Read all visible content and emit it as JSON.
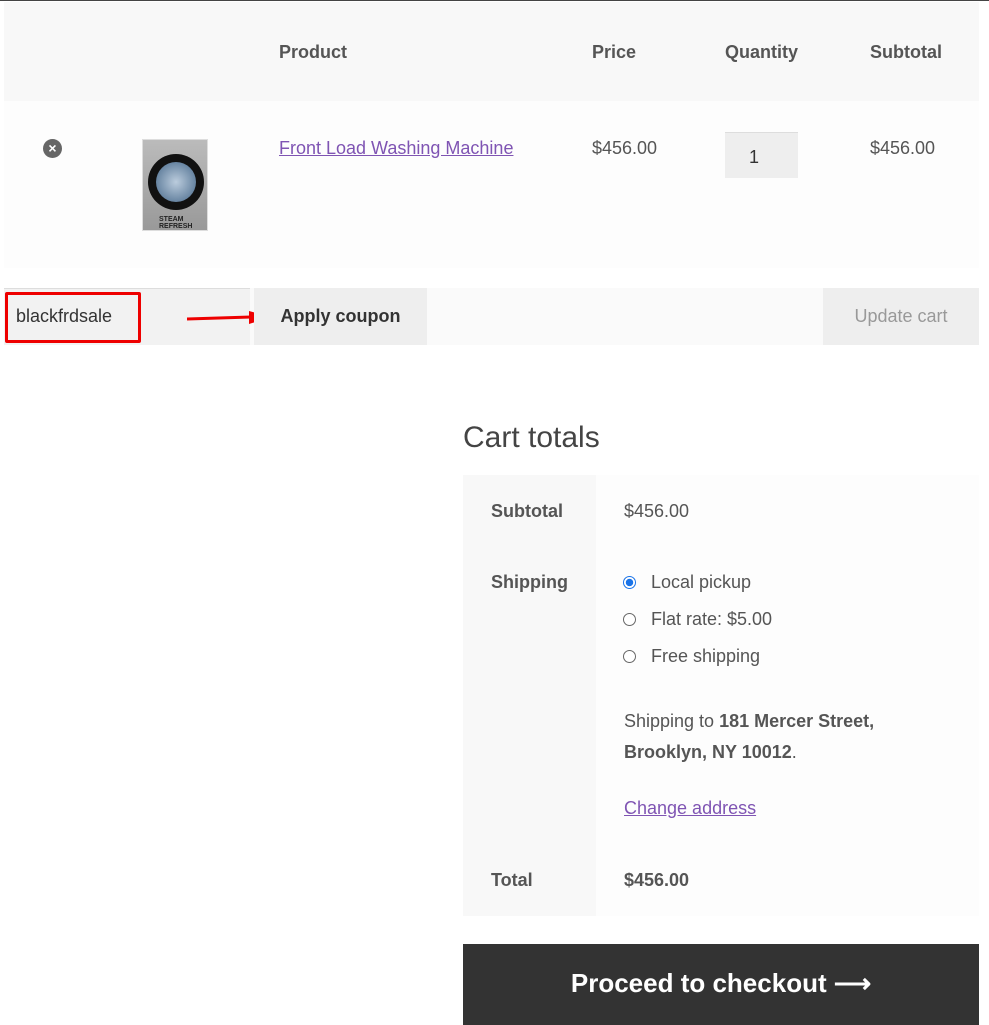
{
  "table": {
    "headers": {
      "product": "Product",
      "price": "Price",
      "quantity": "Quantity",
      "subtotal": "Subtotal"
    },
    "items": [
      {
        "name": "Front Load Washing Machine",
        "image_text": "STEAM REFRESH",
        "price": "$456.00",
        "quantity": "1",
        "subtotal": "$456.00"
      }
    ]
  },
  "coupon": {
    "value": "blackfrdsale",
    "apply_label": "Apply coupon",
    "update_label": "Update cart",
    "highlight_color": "#ee0000"
  },
  "totals": {
    "title": "Cart totals",
    "subtotal_label": "Subtotal",
    "subtotal": "$456.00",
    "shipping_label": "Shipping",
    "options": [
      {
        "label": "Local pickup",
        "selected": true
      },
      {
        "label": "Flat rate: $5.00",
        "selected": false
      },
      {
        "label": "Free shipping",
        "selected": false
      }
    ],
    "ship_to_prefix": "Shipping to ",
    "address_line1": "181 Mercer Street,",
    "address_line2": "Brooklyn, NY 10012",
    "address_suffix": ".",
    "change_address": "Change address",
    "total_label": "Total",
    "total": "$456.00"
  },
  "checkout": {
    "label": "Proceed to checkout",
    "icon": "arrow-right-icon"
  }
}
